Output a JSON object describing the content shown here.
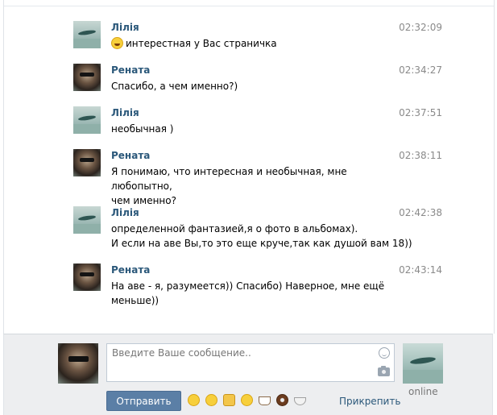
{
  "messages": [
    {
      "author": "Лілія",
      "time": "02:32:09",
      "lines": [
        "интерестная у Вас страничка"
      ],
      "emoji_prefix": "smile-icon"
    },
    {
      "author": "Рената",
      "time": "02:34:27",
      "lines": [
        "Спасибо, а чем именно?)"
      ]
    },
    {
      "author": "Лілія",
      "time": "02:37:51",
      "lines": [
        "необычная )"
      ]
    },
    {
      "author": "Рената",
      "time": "02:38:11",
      "lines": [
        "Я понимаю, что интересная и необычная, мне любопытно,",
        "чем именно?"
      ]
    },
    {
      "author": "Лілія",
      "time": "02:42:38",
      "lines": [
        "определенной фантазией,я о фото в альбомах).",
        "И если на аве Вы,то это еще круче,так как душой вам 18))"
      ]
    },
    {
      "author": "Рената",
      "time": "02:43:14",
      "lines": [
        "На аве - я, разумеется)) Спасибо) Наверное, мне ещё",
        "меньше))"
      ]
    }
  ],
  "composer": {
    "placeholder": "Введите Ваше сообщение..",
    "send_label": "Отправить",
    "attach_label": "Прикрепить",
    "peer_status": "online",
    "emoji_icons": [
      "wink-icon",
      "rolling-eyes-icon",
      "thumbs-up-icon",
      "laughing-icon",
      "coffee-icon",
      "donut-icon",
      "rice-bowl-icon"
    ]
  },
  "colors": {
    "author": "#2b587a",
    "time": "#8a8a8a",
    "send_button": "#5b7fa6",
    "composer_bg": "#edeef0",
    "link": "#2b587a"
  }
}
